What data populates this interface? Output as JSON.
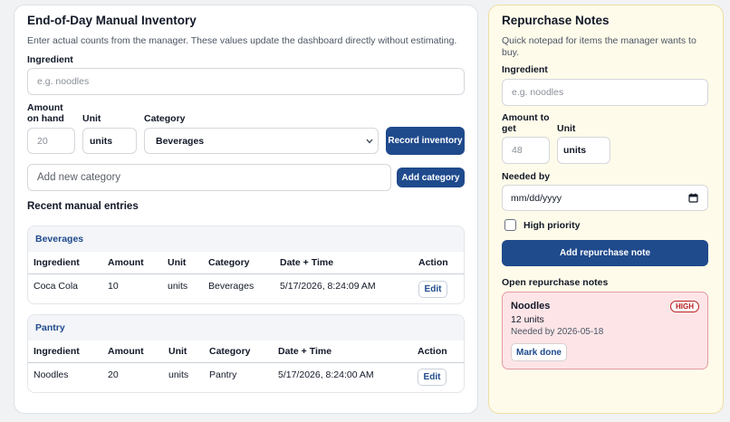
{
  "inventory": {
    "title": "End-of-Day Manual Inventory",
    "subtitle": "Enter actual counts from the manager. These values update the dashboard directly without estimating.",
    "ingredient_label": "Ingredient",
    "ingredient_placeholder": "e.g. noodles",
    "amount_label_1": "Amount",
    "amount_label_2": "on hand",
    "amount_placeholder": "20",
    "unit_label": "Unit",
    "unit_value": "units",
    "category_label": "Category",
    "category_value": "Beverages",
    "record_button": "Record inventory",
    "new_category_placeholder": "Add new category",
    "add_category_button": "Add category",
    "recent_title": "Recent manual entries",
    "columns": [
      "Ingredient",
      "Amount",
      "Unit",
      "Category",
      "Date + Time",
      "Action"
    ],
    "groups": [
      {
        "name": "Beverages",
        "rows": [
          {
            "ingredient": "Coca Cola",
            "amount": "10",
            "unit": "units",
            "category": "Beverages",
            "datetime": "5/17/2026, 8:24:09 AM",
            "action": "Edit"
          }
        ]
      },
      {
        "name": "Pantry",
        "rows": [
          {
            "ingredient": "Noodles",
            "amount": "20",
            "unit": "units",
            "category": "Pantry",
            "datetime": "5/17/2026, 8:24:00 AM",
            "action": "Edit"
          }
        ]
      }
    ]
  },
  "repurchase": {
    "title": "Repurchase Notes",
    "subtitle_1": "Quick notepad for items the manager wants to",
    "subtitle_2": "buy.",
    "ingredient_label": "Ingredient",
    "ingredient_placeholder": "e.g. noodles",
    "amount_label_1": "Amount to",
    "amount_label_2": "get",
    "amount_placeholder": "48",
    "unit_label": "Unit",
    "unit_value": "units",
    "needed_by_label": "Needed by",
    "date_placeholder": "mm/dd/yyyy",
    "priority_label": "High priority",
    "add_button": "Add repurchase note",
    "open_title": "Open repurchase notes",
    "notes": [
      {
        "name": "Noodles",
        "badge": "HIGH",
        "quantity": "12 units",
        "needed": "Needed by 2026-05-18",
        "action": "Mark done"
      }
    ]
  },
  "colors": {
    "accent": "#1f4a8c",
    "note_panel_bg": "#fffbea",
    "high_badge": "#b91c1c"
  }
}
